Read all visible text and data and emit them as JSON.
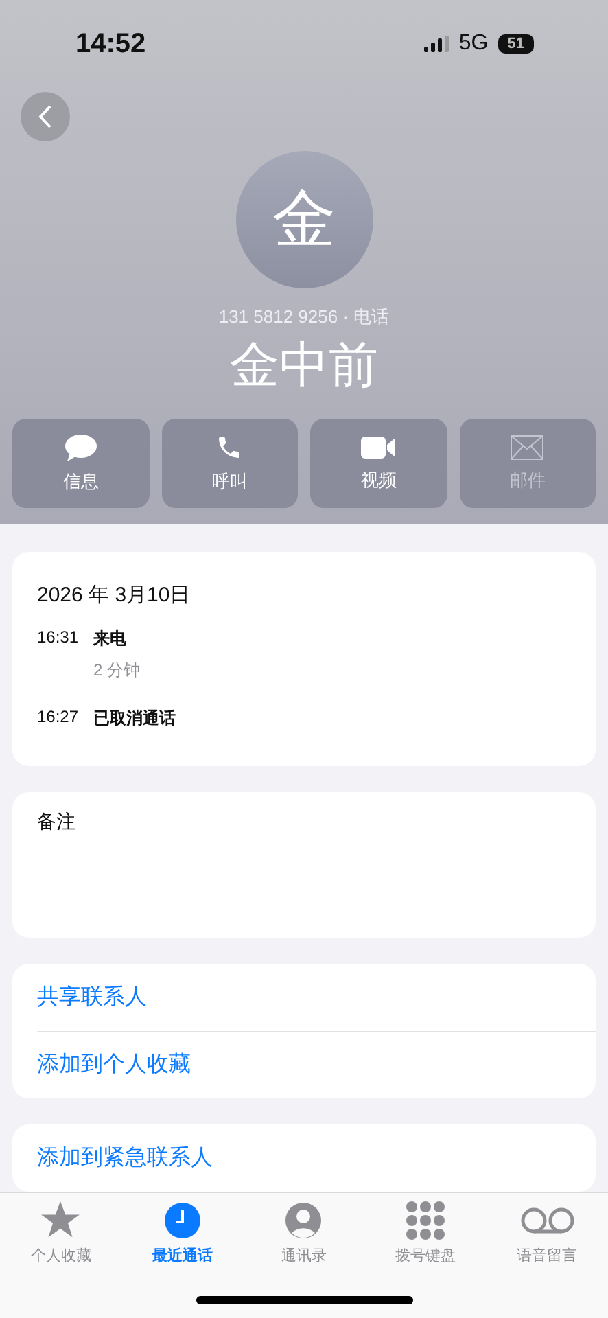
{
  "status_bar": {
    "time": "14:52",
    "network": "5G",
    "battery": "51"
  },
  "contact": {
    "initial": "金",
    "phone": "131 5812 9256 · 电话",
    "name": "金中前"
  },
  "actions": [
    {
      "kind": "message",
      "label": "信息",
      "disabled": false
    },
    {
      "kind": "call",
      "label": "呼叫",
      "disabled": false
    },
    {
      "kind": "video",
      "label": "视频",
      "disabled": false
    },
    {
      "kind": "mail",
      "label": "邮件",
      "disabled": true
    }
  ],
  "recents": {
    "date": "2026 年 3月10日",
    "calls": [
      {
        "time": "16:31",
        "type": "来电",
        "duration": "2 分钟"
      },
      {
        "time": "16:27",
        "type": "已取消通话"
      }
    ]
  },
  "notes": {
    "label": "备注"
  },
  "links": [
    [
      "共享联系人",
      "添加到个人收藏"
    ],
    [
      "添加到紧急联系人"
    ]
  ],
  "tabs": [
    {
      "kind": "favorites",
      "label": "个人收藏",
      "selected": false
    },
    {
      "kind": "recents",
      "label": "最近通话",
      "selected": true
    },
    {
      "kind": "contacts",
      "label": "通讯录",
      "selected": false
    },
    {
      "kind": "keypad",
      "label": "拨号键盘",
      "selected": false
    },
    {
      "kind": "voicemail",
      "label": "语音留言",
      "selected": false
    }
  ]
}
